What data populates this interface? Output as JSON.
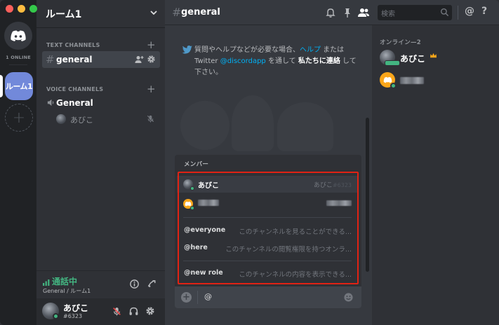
{
  "window": {
    "traffic_colors": [
      "#fc605c",
      "#fdbc40",
      "#34c84a"
    ]
  },
  "rail": {
    "online_label": "1 ONLINE",
    "server_label": "ルーム1",
    "add_glyph": "+"
  },
  "sidebar": {
    "guild_name": "ルーム1",
    "text_category": "TEXT CHANNELS",
    "voice_category": "VOICE CHANNELS",
    "text_channels": [
      {
        "name": "general",
        "selected": true
      }
    ],
    "voice_channels": [
      {
        "name": "General",
        "users": [
          {
            "name": "あびこ"
          }
        ]
      }
    ],
    "voice_status": {
      "state": "通話中",
      "location": "General / ルーム1"
    },
    "user": {
      "name": "あびこ",
      "tag": "#6323"
    }
  },
  "topbar": {
    "channel_hash": "#",
    "channel_name": "general",
    "search_placeholder": "検索",
    "mention_glyph": "@",
    "help_glyph": "?"
  },
  "welcome": {
    "partial_line": "",
    "text_parts": {
      "p1": "質問やヘルプなどが必要な場合、",
      "link1": "ヘルプ",
      "p2": " または Twitter ",
      "link2": "@discordapp",
      "p3": " を通して ",
      "bold": "私たちに連絡",
      "p4": " して下さい。"
    }
  },
  "autocomplete": {
    "header": "メンバー",
    "members": [
      {
        "name": "あびこ",
        "right_name": "あびこ",
        "right_tag": "#6323",
        "selected": true
      },
      {
        "name": "",
        "right_name": "",
        "right_tag": "",
        "selected": false
      }
    ],
    "mentions": [
      {
        "label": "@everyone",
        "desc": "このチャンネルを見ることができる..."
      },
      {
        "label": "@here",
        "desc": "このチャンネルの閲覧権限を持つオンラ..."
      }
    ],
    "roles": [
      {
        "label": "@new role",
        "desc": "このチャンネルの内容を表示できる..."
      }
    ],
    "highlight_color": "#e02214"
  },
  "composer": {
    "value": "@"
  },
  "member_list": {
    "header": "オンライン—2",
    "members": [
      {
        "name": "あびこ",
        "owner": true,
        "streaming": true
      },
      {
        "name": "",
        "owner": false,
        "streaming": false
      }
    ]
  },
  "colors": {
    "accent": "#7289da",
    "online": "#43b581",
    "link": "#00b0f4",
    "owner_crown": "#faa61a"
  }
}
